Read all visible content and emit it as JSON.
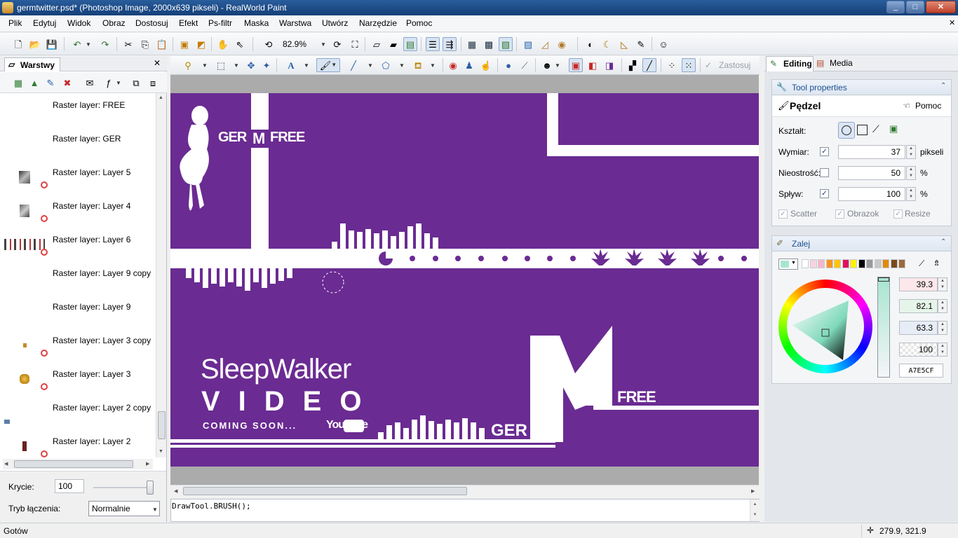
{
  "window": {
    "title": "germtwitter.psd* (Photoshop Image, 2000x639 pikseli) - RealWorld Paint",
    "min": "_",
    "max": "□",
    "close": "✕",
    "doc_close": "✕"
  },
  "menu": [
    "Plik",
    "Edytuj",
    "Widok",
    "Obraz",
    "Dostosuj",
    "Efekt",
    "Ps-filtr",
    "Maska",
    "Warstwa",
    "Utwórz",
    "Narzędzie",
    "Pomoc"
  ],
  "toolbar": {
    "zoom": "82.9%",
    "apply_label": "Zastosuj"
  },
  "layers_panel": {
    "tab_label": "Warstwy",
    "layers": [
      {
        "name": "Raster layer: FREE",
        "hidden": false
      },
      {
        "name": "Raster layer: GER",
        "hidden": false
      },
      {
        "name": "Raster layer: Layer 5",
        "hidden": true
      },
      {
        "name": "Raster layer: Layer 4",
        "hidden": true
      },
      {
        "name": "Raster layer: Layer 6",
        "hidden": true
      },
      {
        "name": "Raster layer: Layer 9 copy",
        "hidden": false
      },
      {
        "name": "Raster layer: Layer 9",
        "hidden": false
      },
      {
        "name": "Raster layer: Layer 3 copy",
        "hidden": true
      },
      {
        "name": "Raster layer: Layer 3",
        "hidden": true
      },
      {
        "name": "Raster layer: Layer 2 copy",
        "hidden": false
      },
      {
        "name": "Raster layer: Layer 2",
        "hidden": true
      }
    ],
    "opacity_label": "Krycie:",
    "opacity_value": "100",
    "blend_label": "Tryb łączenia:",
    "blend_value": "Normalnie"
  },
  "canvas": {
    "bg_color": "#6a2b92",
    "logo_top": "GER",
    "logo_top_m": "M",
    "logo_top_free": "FREE",
    "title_line1": "SleepWalker",
    "title_line2": "VIDEO",
    "coming_soon": "COMING SOON...",
    "youtube": "YouTube",
    "logo_bottom_ger": "GER",
    "logo_bottom_free": "FREE"
  },
  "script_console": "DrawTool.BRUSH();",
  "right_panel": {
    "tab_editing": "Editing",
    "tab_media": "Media",
    "tool_properties": {
      "header": "Tool properties",
      "tool_name": "Pędzel",
      "help": "Pomoc",
      "shape_label": "Kształt:",
      "size_label": "Wymiar:",
      "size_value": "37",
      "size_unit": "pikseli",
      "opacity_label": "Nieostrość:",
      "opacity_value": "50",
      "opacity_unit": "%",
      "flow_label": "Spływ:",
      "flow_value": "100",
      "flow_unit": "%",
      "opt_scatter": "Scatter",
      "opt_image": "Obrazok",
      "opt_resize": "Resize"
    },
    "fill": {
      "header": "Zalej",
      "h": "39.3",
      "s": "82.1",
      "v": "63.3",
      "a": "100",
      "hex": "A7E5CF",
      "current_color": "#a7e5cf",
      "swatches": [
        "#ffffff",
        "#f6d4de",
        "#f8b5c8",
        "#f7931e",
        "#ffc40e",
        "#e0115f",
        "#fff200",
        "#000000",
        "#9a9a9a",
        "#c8c8c8",
        "#e38a0b",
        "#7a4a1a",
        "#9b6a3a"
      ]
    }
  },
  "status": {
    "ready": "Gotów",
    "coords": "279.9, 321.9"
  }
}
